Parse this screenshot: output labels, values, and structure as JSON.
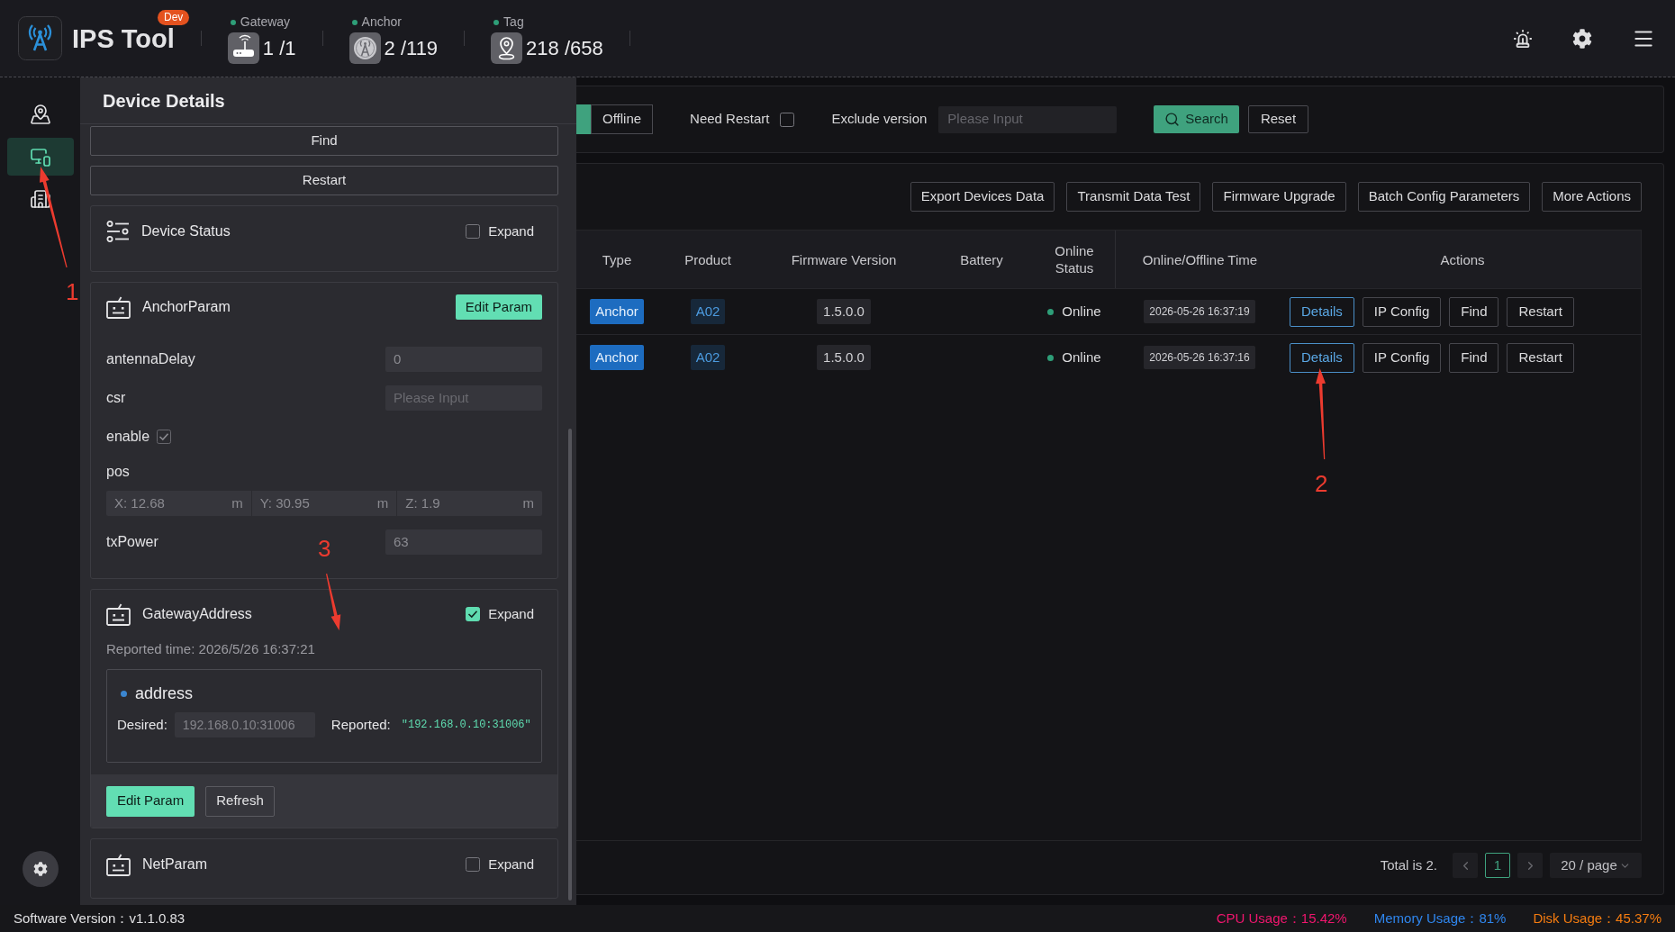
{
  "header": {
    "app_title": "IPS Tool",
    "badge": "Dev",
    "stats": [
      {
        "kind": "gateway",
        "label": "Gateway",
        "count": "1 /1"
      },
      {
        "kind": "anchor",
        "label": "Anchor",
        "count": "2 /119"
      },
      {
        "kind": "tag",
        "label": "Tag",
        "count": "218 /658"
      }
    ]
  },
  "sidebar": {
    "items": [
      {
        "kind": "map",
        "selected": false
      },
      {
        "kind": "devices",
        "selected": true
      },
      {
        "kind": "building",
        "selected": false
      }
    ]
  },
  "drawer": {
    "title": "Device Details",
    "buttons": [
      "Find",
      "Restart"
    ],
    "sections": [
      {
        "kind": "status",
        "title": "Device Status",
        "expand": {
          "label": "Expand",
          "checked": false
        }
      },
      {
        "kind": "param_form",
        "title": "AnchorParam",
        "action": "Edit Param",
        "fields": [
          {
            "kind": "text",
            "label": "antennaDelay",
            "value": "0"
          },
          {
            "kind": "text",
            "label": "csr",
            "placeholder": "Please Input"
          },
          {
            "kind": "checkbox",
            "label": "enable",
            "checked": true
          },
          {
            "kind": "xyz",
            "label": "pos",
            "parts": [
              {
                "value": "X: 12.68",
                "unit": "m"
              },
              {
                "value": "Y: 30.95",
                "unit": "m"
              },
              {
                "value": "Z: 1.9",
                "unit": "m"
              }
            ]
          },
          {
            "kind": "text",
            "label": "txPower",
            "value": "63"
          }
        ]
      },
      {
        "kind": "param_reported",
        "title": "GatewayAddress",
        "expand": {
          "label": "Expand",
          "checked": true
        },
        "reported_time": "Reported time: 2026/5/26 16:37:21",
        "entries": [
          {
            "name": "address",
            "desired_label": "Desired:",
            "desired": "192.168.0.10:31006",
            "reported_label": "Reported:",
            "reported": "\"192.168.0.10:31006\""
          }
        ],
        "actions": [
          {
            "kind": "primary",
            "label": "Edit Param"
          },
          {
            "kind": "default",
            "label": "Refresh"
          }
        ]
      },
      {
        "kind": "param",
        "title": "NetParam",
        "expand": {
          "label": "Expand",
          "checked": false
        }
      }
    ]
  },
  "filters": {
    "status_segments": [
      {
        "selected": true
      },
      {
        "label": "Offline",
        "selected": false
      }
    ],
    "need_restart": {
      "label": "Need Restart",
      "checked": false
    },
    "exclude_version": {
      "label": "Exclude version",
      "placeholder": "Please Input"
    },
    "buttons": [
      {
        "kind": "primary",
        "label": "Search"
      },
      {
        "kind": "default",
        "label": "Reset"
      }
    ]
  },
  "toolbar_buttons": [
    "Export Devices Data",
    "Transmit Data Test",
    "Firmware Upgrade",
    "Batch Config Parameters",
    "More Actions"
  ],
  "table": {
    "columns": [
      "Type",
      "Product",
      "Firmware Version",
      "Battery",
      "Online Status",
      "Online/Offline Time",
      "Actions"
    ],
    "rows": [
      {
        "type": "Anchor",
        "product": "A02",
        "firmware_version": "1.5.0.0",
        "online_status": "Online",
        "online_offline_time": "2026-05-26 16:37:19",
        "actions": [
          {
            "kind": "primary",
            "label": "Details"
          },
          {
            "kind": "default",
            "label": "IP Config"
          },
          {
            "kind": "default",
            "label": "Find"
          },
          {
            "kind": "default",
            "label": "Restart"
          }
        ]
      },
      {
        "type": "Anchor",
        "product": "A02",
        "firmware_version": "1.5.0.0",
        "online_status": "Online",
        "online_offline_time": "2026-05-26 16:37:16",
        "actions": [
          {
            "kind": "primary",
            "label": "Details"
          },
          {
            "kind": "default",
            "label": "IP Config"
          },
          {
            "kind": "default",
            "label": "Find"
          },
          {
            "kind": "default",
            "label": "Restart"
          }
        ]
      }
    ]
  },
  "pagination": {
    "total": "Total is 2.",
    "pages": [
      {
        "label": "1",
        "selected": true
      }
    ],
    "page_size": "20 / page"
  },
  "status_bar": {
    "version": "Software Version：v1.1.0.83",
    "usages": [
      {
        "text": "CPU Usage：15.42%",
        "color": "#f0166e"
      },
      {
        "text": "Memory Usage：81%",
        "color": "#2f86ee"
      },
      {
        "text": "Disk Usage：45.37%",
        "color": "#f57c10"
      }
    ]
  },
  "annotations": [
    {
      "label": "1"
    },
    {
      "label": "2"
    },
    {
      "label": "3"
    }
  ]
}
